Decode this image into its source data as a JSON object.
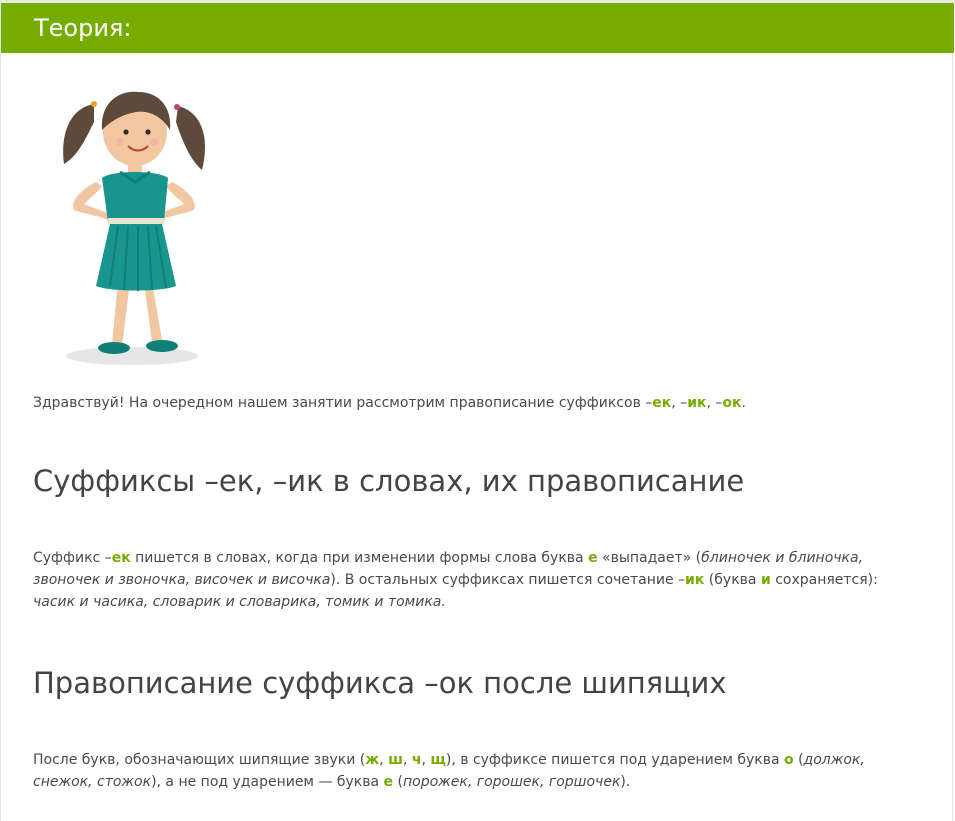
{
  "header": {
    "title": "Теория:"
  },
  "illustration": {
    "icon": "cartoon-girl"
  },
  "intro": {
    "t1": "Здравствуй! На очередном нашем занятии рассмотрим правописание суффиксов –",
    "s1": "ек",
    "t2": ", –",
    "s2": "ик",
    "t3": ", –",
    "s3": "ок",
    "t4": "."
  },
  "section1": {
    "heading": "Суффиксы –ек, –ик в словах, их правописание",
    "t1": "Суффикс –",
    "s1": "ек",
    "t2": " пишется в словах, когда при изменении формы слова буква ",
    "s2": "е",
    "t3": " «выпадает» (",
    "i1": "блиночек и блиночка, звоночек и звоночка, височек и височка",
    "t4": "). В остальных суффиксах пишется сочетание –",
    "s3": "ик",
    "t5": " (буква ",
    "s4": "и",
    "t6": " сохраняется): ",
    "i2": "часик и часика, словарик и словарика, томик и томика."
  },
  "section2": {
    "heading": "Правописание суффикса –ок после шипящих",
    "t1": "После букв, обозначающих шипящие звуки (",
    "l1": "ж",
    "c1": ", ",
    "l2": "ш",
    "c2": ", ",
    "l3": "ч",
    "c3": ", ",
    "l4": "щ",
    "t2": "), в суффиксе пишется под ударением буква ",
    "s1": "о",
    "t3": " (",
    "i1": "должок, снежок, стожок",
    "t4": "), а не под ударением — буква ",
    "s2": "е",
    "t5": " (",
    "i2": "порожек,  горошек, горшочек",
    "t6": ")."
  },
  "colors": {
    "accent": "#76ac00",
    "text": "#4a4a4a"
  }
}
